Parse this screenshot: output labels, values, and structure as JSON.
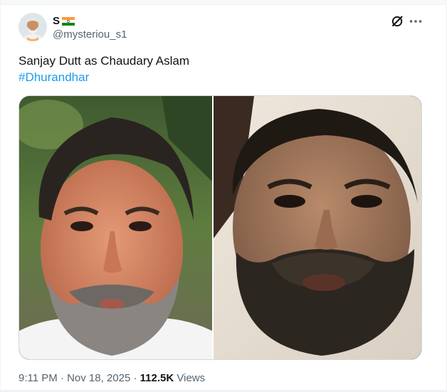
{
  "author": {
    "display_name": "S",
    "handle": "@mysteriou_s1"
  },
  "tweet": {
    "text": "Sanjay Dutt as Chaudary Aslam",
    "hashtag": "#Dhurandhar"
  },
  "media": {
    "left_image": "photo-portrait-bearded-man-1",
    "right_image": "photo-portrait-bearded-man-2"
  },
  "meta": {
    "time": "9:11 PM",
    "separator": "·",
    "date": "Nov 18, 2025",
    "views_count": "112.5K",
    "views_label": "Views"
  },
  "colors": {
    "link": "#1d9bf0",
    "secondary_text": "#536471",
    "primary_text": "#0f1419"
  }
}
